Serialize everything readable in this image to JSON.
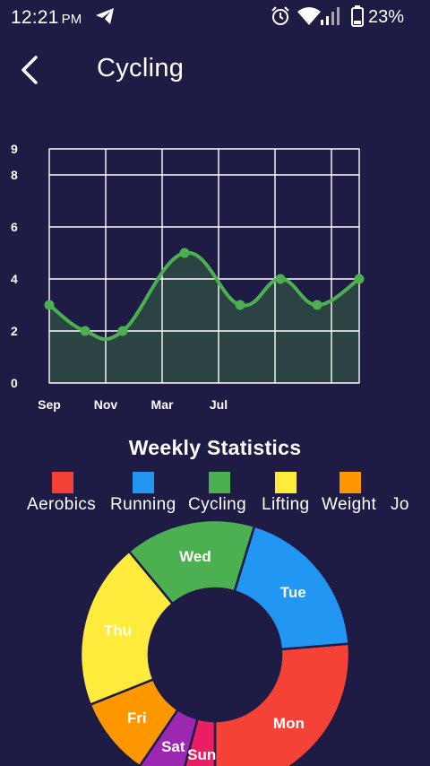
{
  "status_bar": {
    "time": "12:21",
    "ampm": "PM",
    "battery": "23%"
  },
  "header": {
    "title": "Cycling"
  },
  "chart_data": {
    "type": "line",
    "categories": [
      "Sep",
      "Nov",
      "Mar",
      "Jul"
    ],
    "x_tick_labels": [
      "Sep",
      "Nov",
      "Mar",
      "Jul"
    ],
    "y_tick_labels": [
      "0",
      "2",
      "4",
      "6",
      "8",
      "9"
    ],
    "ylim": [
      0,
      9
    ],
    "series": [
      {
        "values": [
          3,
          2,
          2,
          5,
          3,
          4,
          3,
          4
        ],
        "color": "#4caf50"
      }
    ],
    "grid": true,
    "fill": "#2e4a43"
  },
  "weekly": {
    "title": "Weekly Statistics",
    "legend": [
      {
        "label": "Aerobics",
        "color": "#f44336"
      },
      {
        "label": "Running",
        "color": "#2196f3"
      },
      {
        "label": "Cycling",
        "color": "#4caf50"
      },
      {
        "label": "Lifting",
        "color": "#ffeb3b"
      },
      {
        "label": "Weight",
        "color": "#ff9800"
      },
      {
        "label": "Jo",
        "color": "#9c27b0"
      }
    ],
    "donut": {
      "type": "pie",
      "slices": [
        {
          "label": "Mon",
          "value": 25,
          "color": "#f44336"
        },
        {
          "label": "Tue",
          "value": 18,
          "color": "#2196f3"
        },
        {
          "label": "Wed",
          "value": 15,
          "color": "#4caf50"
        },
        {
          "label": "Thu",
          "value": 19,
          "color": "#ffeb3b"
        },
        {
          "label": "Fri",
          "value": 9,
          "color": "#ff9800"
        },
        {
          "label": "Sat",
          "value": 5,
          "color": "#9c27b0"
        },
        {
          "label": "Sun",
          "value": 4,
          "color": "#e91e63"
        }
      ]
    }
  },
  "icons": {
    "telegram": "telegram-icon",
    "alarm": "alarm-icon",
    "wifi": "wifi-icon",
    "signal": "signal-icon",
    "battery": "battery-icon",
    "back": "back-arrow-icon"
  }
}
